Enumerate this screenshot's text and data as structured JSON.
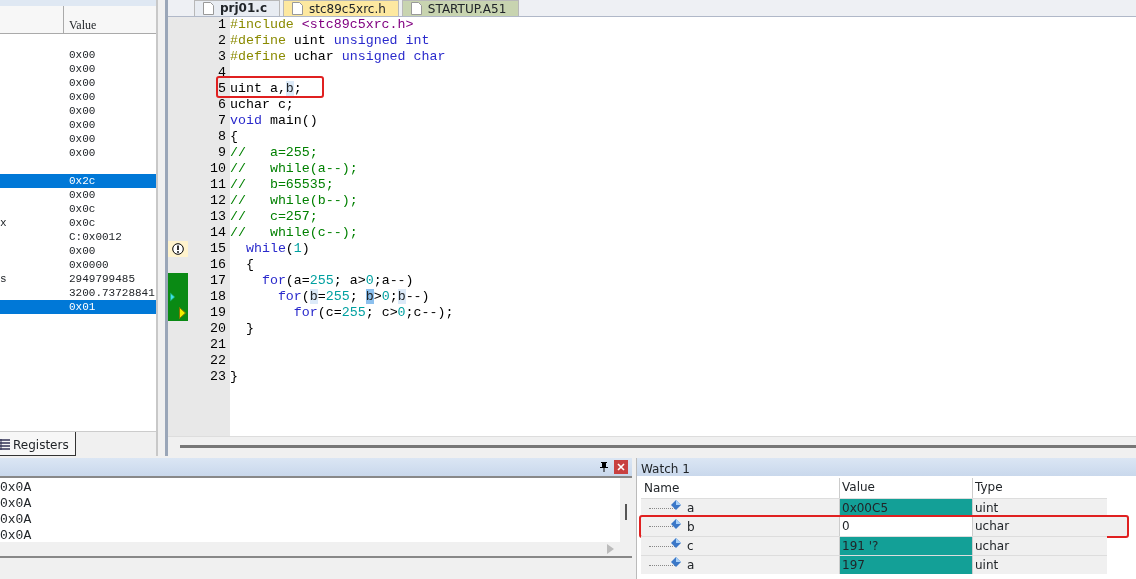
{
  "registers_panel": {
    "value_header": "Value",
    "groups": [
      {
        "rows": [
          {
            "value": "0x00",
            "selected": false
          },
          {
            "value": "0x00",
            "selected": false
          },
          {
            "value": "0x00",
            "selected": false
          },
          {
            "value": "0x00",
            "selected": false
          },
          {
            "value": "0x00",
            "selected": false
          },
          {
            "value": "0x00",
            "selected": false
          },
          {
            "value": "0x00",
            "selected": false
          },
          {
            "value": "0x00",
            "selected": false
          }
        ]
      },
      {
        "rows": [
          {
            "value": "0x2c",
            "selected": true
          },
          {
            "value": "0x00",
            "selected": false
          },
          {
            "value": "0x0c",
            "selected": false
          },
          {
            "name": "x",
            "value": "0x0c",
            "selected": false
          },
          {
            "value": "C:0x0012",
            "selected": false
          },
          {
            "value": "0x00",
            "selected": false
          },
          {
            "value": "0x0000",
            "selected": false
          },
          {
            "name": "s",
            "value": "2949799485",
            "selected": false
          },
          {
            "value": "3200.73728841",
            "selected": false
          },
          {
            "value": "0x01",
            "selected": true
          }
        ]
      }
    ],
    "tab": "Registers"
  },
  "editor": {
    "tabs": [
      {
        "label": "prj01.c",
        "selected": true,
        "color": "#e8ecf2"
      },
      {
        "label": "stc89c5xrc.h",
        "selected": false,
        "color": "#fde8a0"
      },
      {
        "label": "STARTUP.A51",
        "selected": false,
        "color": "#c8d4b0"
      }
    ],
    "lines": [
      {
        "number": "1",
        "tokens": [
          {
            "kind": "pp",
            "text": "#include "
          },
          {
            "kind": "str",
            "text": "<stc89c5xrc.h>"
          }
        ]
      },
      {
        "number": "2",
        "tokens": [
          {
            "kind": "pp",
            "text": "#define "
          },
          {
            "kind": "plain",
            "text": "uint "
          },
          {
            "kind": "kw",
            "text": "unsigned int"
          }
        ]
      },
      {
        "number": "3",
        "tokens": [
          {
            "kind": "pp",
            "text": "#define "
          },
          {
            "kind": "plain",
            "text": "uchar "
          },
          {
            "kind": "kw",
            "text": "unsigned char"
          }
        ]
      },
      {
        "number": "4"
      },
      {
        "number": "5",
        "annotated": true,
        "tokens": [
          {
            "kind": "plain",
            "text": "uint a,"
          },
          {
            "kind": "match",
            "text": "b"
          },
          {
            "kind": "plain",
            "text": ";"
          }
        ]
      },
      {
        "number": "6",
        "tokens": [
          {
            "kind": "plain",
            "text": "uchar c;"
          }
        ]
      },
      {
        "number": "7",
        "tokens": [
          {
            "kind": "kw",
            "text": "void "
          },
          {
            "kind": "plain",
            "text": "main()"
          }
        ]
      },
      {
        "number": "8",
        "tokens": [
          {
            "kind": "plain",
            "text": "{"
          }
        ]
      },
      {
        "number": "9",
        "tokens": [
          {
            "kind": "cm",
            "text": "//   a=255;"
          }
        ]
      },
      {
        "number": "10",
        "tokens": [
          {
            "kind": "cm",
            "text": "//   while(a--);"
          }
        ]
      },
      {
        "number": "11",
        "tokens": [
          {
            "kind": "cm",
            "text": "//   b=65535;"
          }
        ]
      },
      {
        "number": "12",
        "tokens": [
          {
            "kind": "cm",
            "text": "//   while(b--);"
          }
        ]
      },
      {
        "number": "13",
        "tokens": [
          {
            "kind": "cm",
            "text": "//   c=257;"
          }
        ]
      },
      {
        "number": "14",
        "tokens": [
          {
            "kind": "cm",
            "text": "//   while(c--);"
          }
        ]
      },
      {
        "number": "15",
        "warning": true,
        "tokens": [
          {
            "kind": "kw",
            "text": "  while"
          },
          {
            "kind": "plain",
            "text": "("
          },
          {
            "kind": "num",
            "text": "1"
          },
          {
            "kind": "plain",
            "text": ")"
          }
        ]
      },
      {
        "number": "16",
        "tokens": [
          {
            "kind": "plain",
            "text": "  {"
          }
        ]
      },
      {
        "number": "17",
        "covered": true,
        "tokens": [
          {
            "kind": "kw",
            "text": "    for"
          },
          {
            "kind": "plain",
            "text": "(a="
          },
          {
            "kind": "num",
            "text": "255"
          },
          {
            "kind": "plain",
            "text": "; a>"
          },
          {
            "kind": "num",
            "text": "0"
          },
          {
            "kind": "plain",
            "text": ";a--)"
          }
        ]
      },
      {
        "number": "18",
        "covered": true,
        "caller": true,
        "tokens": [
          {
            "kind": "kw",
            "text": "      for"
          },
          {
            "kind": "plain",
            "text": "("
          },
          {
            "kind": "match",
            "text": "b"
          },
          {
            "kind": "plain",
            "text": "="
          },
          {
            "kind": "num",
            "text": "255"
          },
          {
            "kind": "plain",
            "text": "; "
          },
          {
            "kind": "sel",
            "text": "b"
          },
          {
            "kind": "plain",
            "text": ">"
          },
          {
            "kind": "num",
            "text": "0"
          },
          {
            "kind": "plain",
            "text": ";"
          },
          {
            "kind": "match",
            "text": "b"
          },
          {
            "kind": "plain",
            "text": "--)"
          }
        ]
      },
      {
        "number": "19",
        "covered": true,
        "current": true,
        "tokens": [
          {
            "kind": "kw",
            "text": "        for"
          },
          {
            "kind": "plain",
            "text": "(c="
          },
          {
            "kind": "num",
            "text": "255"
          },
          {
            "kind": "plain",
            "text": "; c>"
          },
          {
            "kind": "num",
            "text": "0"
          },
          {
            "kind": "plain",
            "text": ";c--);"
          }
        ]
      },
      {
        "number": "20",
        "tokens": [
          {
            "kind": "plain",
            "text": "  }"
          }
        ]
      },
      {
        "number": "21"
      },
      {
        "number": "22"
      },
      {
        "number": "23",
        "tokens": [
          {
            "kind": "plain",
            "text": "}"
          }
        ]
      }
    ]
  },
  "output_panel": {
    "lines": [
      "0x0A",
      "0x0A",
      "0x0A",
      "0x0A"
    ]
  },
  "watch_panel": {
    "title": "Watch 1",
    "columns": [
      "Name",
      "Value",
      "Type"
    ],
    "rows": [
      {
        "name": "a",
        "value": "0x00C5",
        "type": "uint",
        "changed": true,
        "annotated": false
      },
      {
        "name": "b",
        "value": "0",
        "type": "uchar",
        "changed": false,
        "annotated": true
      },
      {
        "name": "c",
        "value": "191 '?",
        "type": "uchar",
        "changed": true,
        "annotated": false
      },
      {
        "name": "a",
        "value": "197",
        "type": "uint",
        "changed": true,
        "annotated": false
      }
    ]
  }
}
